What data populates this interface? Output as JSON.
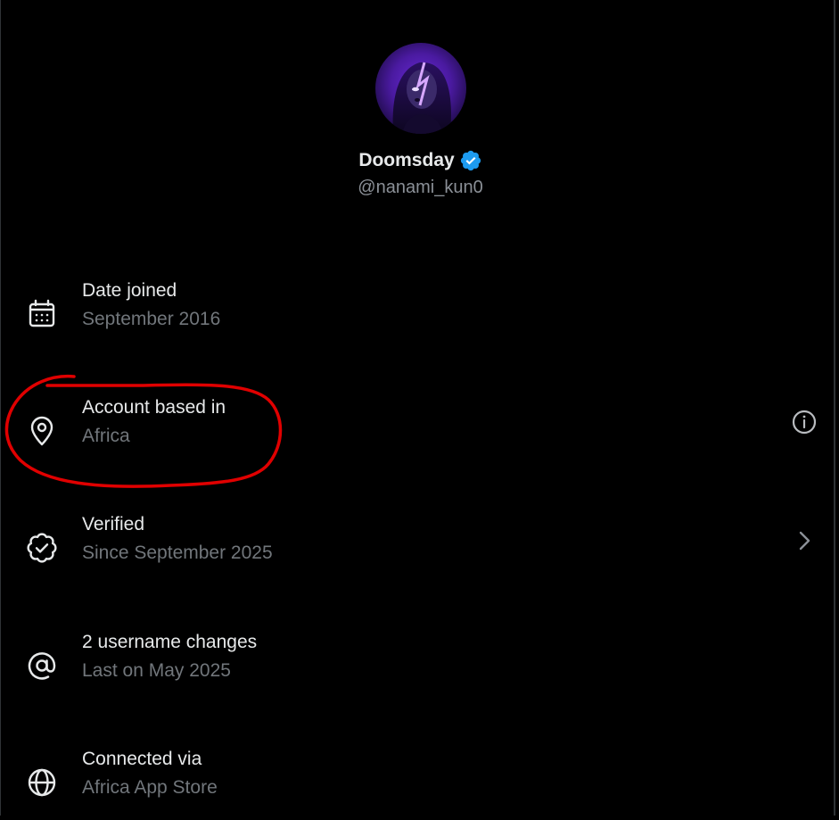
{
  "profile": {
    "display_name": "Doomsday",
    "handle": "@nanami_kun0",
    "verified": true,
    "badge_color": "#1d9bf0"
  },
  "rows": [
    {
      "label": "Date joined",
      "sub": "September 2016",
      "icon": "calendar-icon"
    },
    {
      "label": "Account based in",
      "sub": "Africa",
      "icon": "location-pin-icon",
      "trailing": "info-icon"
    },
    {
      "label": "Verified",
      "sub": "Since September 2025",
      "icon": "verified-check-icon",
      "trailing": "chevron-right-icon"
    },
    {
      "label": "2 username changes",
      "sub": "Last on May 2025",
      "icon": "at-sign-icon"
    },
    {
      "label": "Connected via",
      "sub": "Africa App Store",
      "icon": "globe-icon"
    }
  ],
  "colors": {
    "background": "#000000",
    "primary_text": "#e7e9ea",
    "secondary_text": "#71767b",
    "annotation": "#e00000"
  }
}
